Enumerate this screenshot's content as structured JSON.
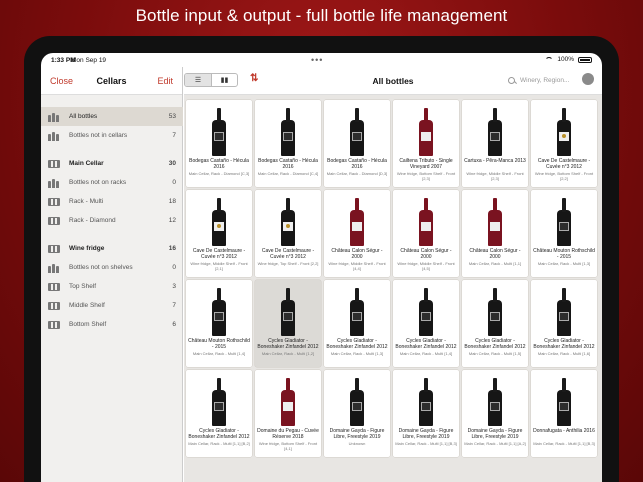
{
  "promo_title": "Bottle input & output - full bottle life management",
  "status_bar": {
    "time": "1:33 PM",
    "date": "Mon Sep 19",
    "battery": "100%"
  },
  "sidebar": {
    "close_label": "Close",
    "title": "Cellars",
    "edit_label": "Edit",
    "items": [
      {
        "label": "All bottles",
        "count": "53",
        "icon": "bottles-icon"
      },
      {
        "label": "Bottles not in cellars",
        "count": "7",
        "icon": "bottles-icon"
      },
      {
        "label": "Main Cellar",
        "count": "30",
        "icon": "cellar-icon"
      },
      {
        "label": "Bottles not on racks",
        "count": "0",
        "icon": "bottles-icon"
      },
      {
        "label": "Rack - Multi",
        "count": "18",
        "icon": "rack-icon"
      },
      {
        "label": "Rack - Diamond",
        "count": "12",
        "icon": "rack-icon"
      },
      {
        "label": "Wine fridge",
        "count": "16",
        "icon": "fridge-icon"
      },
      {
        "label": "Bottles not on shelves",
        "count": "0",
        "icon": "bottles-icon"
      },
      {
        "label": "Top Shelf",
        "count": "3",
        "icon": "shelf-icon"
      },
      {
        "label": "Middle Shelf",
        "count": "7",
        "icon": "shelf-icon"
      },
      {
        "label": "Bottom Shelf",
        "count": "6",
        "icon": "shelf-icon"
      }
    ]
  },
  "main": {
    "title": "All bottles",
    "search_placeholder": "Winery, Region...",
    "view_list_icon": "list-view-icon",
    "view_rack_icon": "rack-view-icon",
    "sort_icon": "sort-icon",
    "bottles": [
      {
        "name": "Bodegas Castaño - Hécula 2016",
        "location": "Main Cellar, Rack - Diamond [C,3]",
        "style": "dark"
      },
      {
        "name": "Bodegas Castaño - Hécula 2016",
        "location": "Main Cellar, Rack - Diamond [C,4]",
        "style": "dark"
      },
      {
        "name": "Bodegas Castaño - Hécula 2016",
        "location": "Main Cellar, Rack - Diamond [D,3]",
        "style": "dark"
      },
      {
        "name": "Cailtena Tributo - Single Vineyard 2007",
        "location": "Wine fridge, Bottom Shelf - Front [2,3]",
        "style": "red"
      },
      {
        "name": "Cartuxa - Pêra-Manca 2013",
        "location": "Wine fridge, Middle Shelf - Front [2,3]",
        "style": "dark"
      },
      {
        "name": "Cave De Castelmaure - Cuvée n°3 2012",
        "location": "Wine fridge, Bottom Shelf - Front [2,2]",
        "style": "crest"
      },
      {
        "name": "Cave De Castelmaure - Cuvée n°3 2012",
        "location": "Wine fridge, Middle Shelf - Front [2,1]",
        "style": "crest"
      },
      {
        "name": "Cave De Castelmaure - Cuvée n°3 2012",
        "location": "Wine fridge, Top Shelf - Front [2,2]",
        "style": "crest"
      },
      {
        "name": "Château Calon Ségur - 2000",
        "location": "Wine fridge, Middle Shelf - Front [4,4]",
        "style": "red"
      },
      {
        "name": "Château Calon Ségur - 2000",
        "location": "Wine fridge, Middle Shelf - Front [4,5]",
        "style": "red"
      },
      {
        "name": "Château Calon Ségur - 2000",
        "location": "Main Cellar, Rack - Multi [1,1]",
        "style": "red"
      },
      {
        "name": "Château Mouton Rothschild - 2015",
        "location": "Main Cellar, Rack - Multi [1,3]",
        "style": "dark"
      },
      {
        "name": "Château Mouton Rothschild - 2015",
        "location": "Main Cellar, Rack - Multi [1,4]",
        "style": "dark"
      },
      {
        "name": "Cycles Gladiator - Boneshaker Zinfandel 2012",
        "location": "Main Cellar, Rack - Multi [1,2]",
        "style": "dark"
      },
      {
        "name": "Cycles Gladiator - Boneshaker Zinfandel 2012",
        "location": "Main Cellar, Rack - Multi [1,3]",
        "style": "dark"
      },
      {
        "name": "Cycles Gladiator - Boneshaker Zinfandel 2012",
        "location": "Main Cellar, Rack - Multi [1,4]",
        "style": "dark"
      },
      {
        "name": "Cycles Gladiator - Boneshaker Zinfandel 2012",
        "location": "Main Cellar, Rack - Multi [1,5]",
        "style": "dark"
      },
      {
        "name": "Cycles Gladiator - Boneshaker Zinfandel 2012",
        "location": "Main Cellar, Rack - Multi [1,6]",
        "style": "dark"
      },
      {
        "name": "Cycles Gladiator - Boneshaker Zinfandel 2012",
        "location": "Main Cellar, Rack - Multi [1,1] [B,2]",
        "style": "dark"
      },
      {
        "name": "Domaine du Pegau - Cuvée Réserve 2018",
        "location": "Wine fridge, Bottom Shelf - Front [4,1]",
        "style": "red"
      },
      {
        "name": "Domaine Gayda - Figure Libre, Freestyle 2019",
        "location": "Unknown",
        "style": "dark"
      },
      {
        "name": "Domaine Gayda - Figure Libre, Freestyle 2019",
        "location": "Main Cellar, Rack - Multi [1,1] [B,3]",
        "style": "dark"
      },
      {
        "name": "Domaine Gayda - Figure Libre, Freestyle 2019",
        "location": "Main Cellar, Rack - Multi [1,1] [A,2]",
        "style": "dark"
      },
      {
        "name": "Donnafugata - Anthilia 2016",
        "location": "Main Cellar, Rack - Multi [1,1] [B,3]",
        "style": "dark"
      }
    ]
  },
  "colors": {
    "accent": "#c0392b",
    "background": "#8b1010"
  }
}
